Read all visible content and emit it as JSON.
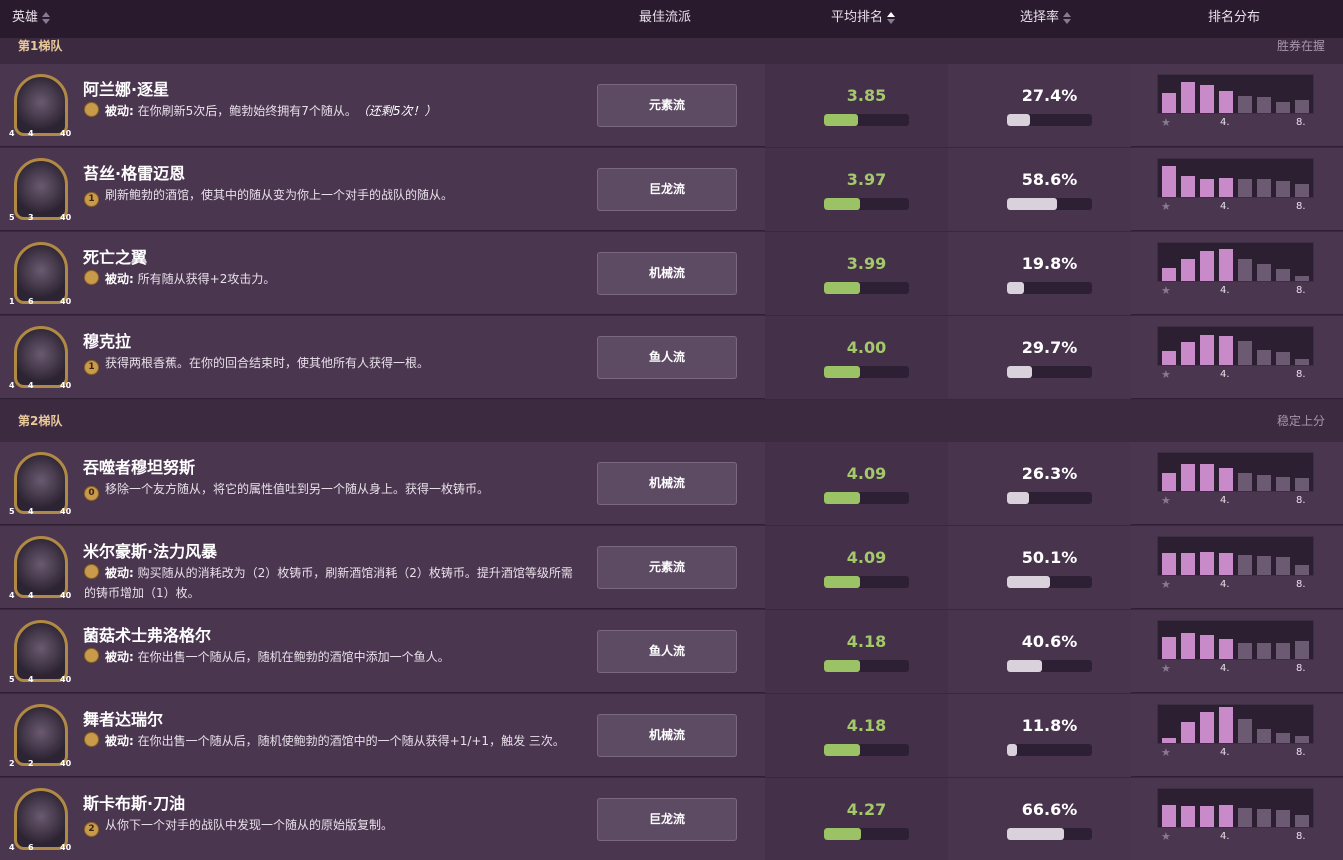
{
  "header": {
    "hero": "英雄",
    "comp": "最佳流派",
    "avg": "平均排名",
    "pick": "选择率",
    "dist": "排名分布"
  },
  "colors": {
    "avg_fill": "#9bc264",
    "pick_fill": "#d9d2dc",
    "dist_top": "#c88ac9",
    "dist_bottom": "#6c5a72"
  },
  "dist_labels": {
    "mid": "4.",
    "end": "8."
  },
  "tiers": [
    {
      "name": "第1梯队",
      "desc": "胜券在握"
    },
    {
      "name": "第2梯队",
      "desc": "稳定上分"
    }
  ],
  "heroes": [
    {
      "name": "阿兰娜·逐星",
      "coin": "",
      "power_prefix": "被动:",
      "power": "在你刷新5次后，鲍勃始终拥有7个随从。",
      "power_note": "（还剩5次！）",
      "comp": "元素流",
      "avg": "3.85",
      "avg_pct": 0.4,
      "pick": "27.4%",
      "pick_pct": 0.274,
      "stats": [
        "4",
        "4",
        "40"
      ],
      "dist": [
        0.55,
        0.85,
        0.78,
        0.62,
        0.48,
        0.44,
        0.3,
        0.35
      ]
    },
    {
      "name": "苔丝·格雷迈恩",
      "coin": "1",
      "power_prefix": "",
      "power": "刷新鲍勃的酒馆，使其中的随从变为你上一个对手的战队的随从。",
      "power_note": "",
      "comp": "巨龙流",
      "avg": "3.97",
      "avg_pct": 0.42,
      "pick": "58.6%",
      "pick_pct": 0.586,
      "stats": [
        "5",
        "3",
        "40"
      ],
      "dist": [
        0.85,
        0.58,
        0.5,
        0.52,
        0.5,
        0.49,
        0.45,
        0.36
      ]
    },
    {
      "name": "死亡之翼",
      "coin": "",
      "power_prefix": "被动:",
      "power": "所有随从获得+2攻击力。",
      "power_note": "",
      "comp": "机械流",
      "avg": "3.99",
      "avg_pct": 0.42,
      "pick": "19.8%",
      "pick_pct": 0.198,
      "stats": [
        "1",
        "6",
        "40"
      ],
      "dist": [
        0.36,
        0.62,
        0.82,
        0.9,
        0.62,
        0.48,
        0.32,
        0.15
      ]
    },
    {
      "name": "穆克拉",
      "coin": "1",
      "power_prefix": "",
      "power": "获得两根香蕉。在你的回合结束时，使其他所有人获得一根。",
      "power_note": "",
      "comp": "鱼人流",
      "avg": "4.00",
      "avg_pct": 0.42,
      "pick": "29.7%",
      "pick_pct": 0.297,
      "stats": [
        "4",
        "4",
        "40"
      ],
      "dist": [
        0.38,
        0.65,
        0.82,
        0.8,
        0.67,
        0.42,
        0.36,
        0.18
      ]
    },
    {
      "name": "吞噬者穆坦努斯",
      "coin": "0",
      "power_prefix": "",
      "power": "移除一个友方随从，将它的属性值吐到另一个随从身上。获得一枚铸币。",
      "power_note": "",
      "comp": "机械流",
      "avg": "4.09",
      "avg_pct": 0.42,
      "pick": "26.3%",
      "pick_pct": 0.263,
      "stats": [
        "5",
        "4",
        "40"
      ],
      "dist": [
        0.5,
        0.75,
        0.75,
        0.65,
        0.5,
        0.45,
        0.4,
        0.35
      ]
    },
    {
      "name": "米尔豪斯·法力风暴",
      "coin": "",
      "power_prefix": "被动:",
      "power": "购买随从的消耗改为（2）枚铸币，刷新酒馆消耗（2）枚铸币。提升酒馆等级所需的铸币增加（1）枚。",
      "power_note": "",
      "comp": "元素流",
      "avg": "4.09",
      "avg_pct": 0.42,
      "pick": "50.1%",
      "pick_pct": 0.501,
      "stats": [
        "4",
        "4",
        "40"
      ],
      "dist": [
        0.62,
        0.62,
        0.65,
        0.62,
        0.55,
        0.52,
        0.5,
        0.28
      ]
    },
    {
      "name": "菌菇术士弗洛格尔",
      "coin": "",
      "power_prefix": "被动:",
      "power": "在你出售一个随从后，随机在鲍勃的酒馆中添加一个鱼人。",
      "power_note": "",
      "comp": "鱼人流",
      "avg": "4.18",
      "avg_pct": 0.42,
      "pick": "40.6%",
      "pick_pct": 0.406,
      "stats": [
        "5",
        "4",
        "40"
      ],
      "dist": [
        0.6,
        0.72,
        0.68,
        0.55,
        0.45,
        0.45,
        0.45,
        0.5
      ]
    },
    {
      "name": "舞者达瑞尔",
      "coin": "",
      "power_prefix": "被动:",
      "power": "在你出售一个随从后，随机使鲍勃的酒馆中的一个随从获得+1/+1，触发 三次。",
      "power_note": "",
      "comp": "机械流",
      "avg": "4.18",
      "avg_pct": 0.42,
      "pick": "11.8%",
      "pick_pct": 0.118,
      "stats": [
        "2",
        "2",
        "40"
      ],
      "dist": [
        0.15,
        0.58,
        0.85,
        1.0,
        0.68,
        0.4,
        0.28,
        0.2
      ]
    },
    {
      "name": "斯卡布斯·刀油",
      "coin": "2",
      "power_prefix": "",
      "power": "从你下一个对手的战队中发现一个随从的原始版复制。",
      "power_note": "",
      "comp": "巨龙流",
      "avg": "4.27",
      "avg_pct": 0.43,
      "pick": "66.6%",
      "pick_pct": 0.666,
      "stats": [
        "4",
        "6",
        "40"
      ],
      "dist": [
        0.62,
        0.58,
        0.58,
        0.6,
        0.52,
        0.5,
        0.48,
        0.32
      ]
    }
  ]
}
